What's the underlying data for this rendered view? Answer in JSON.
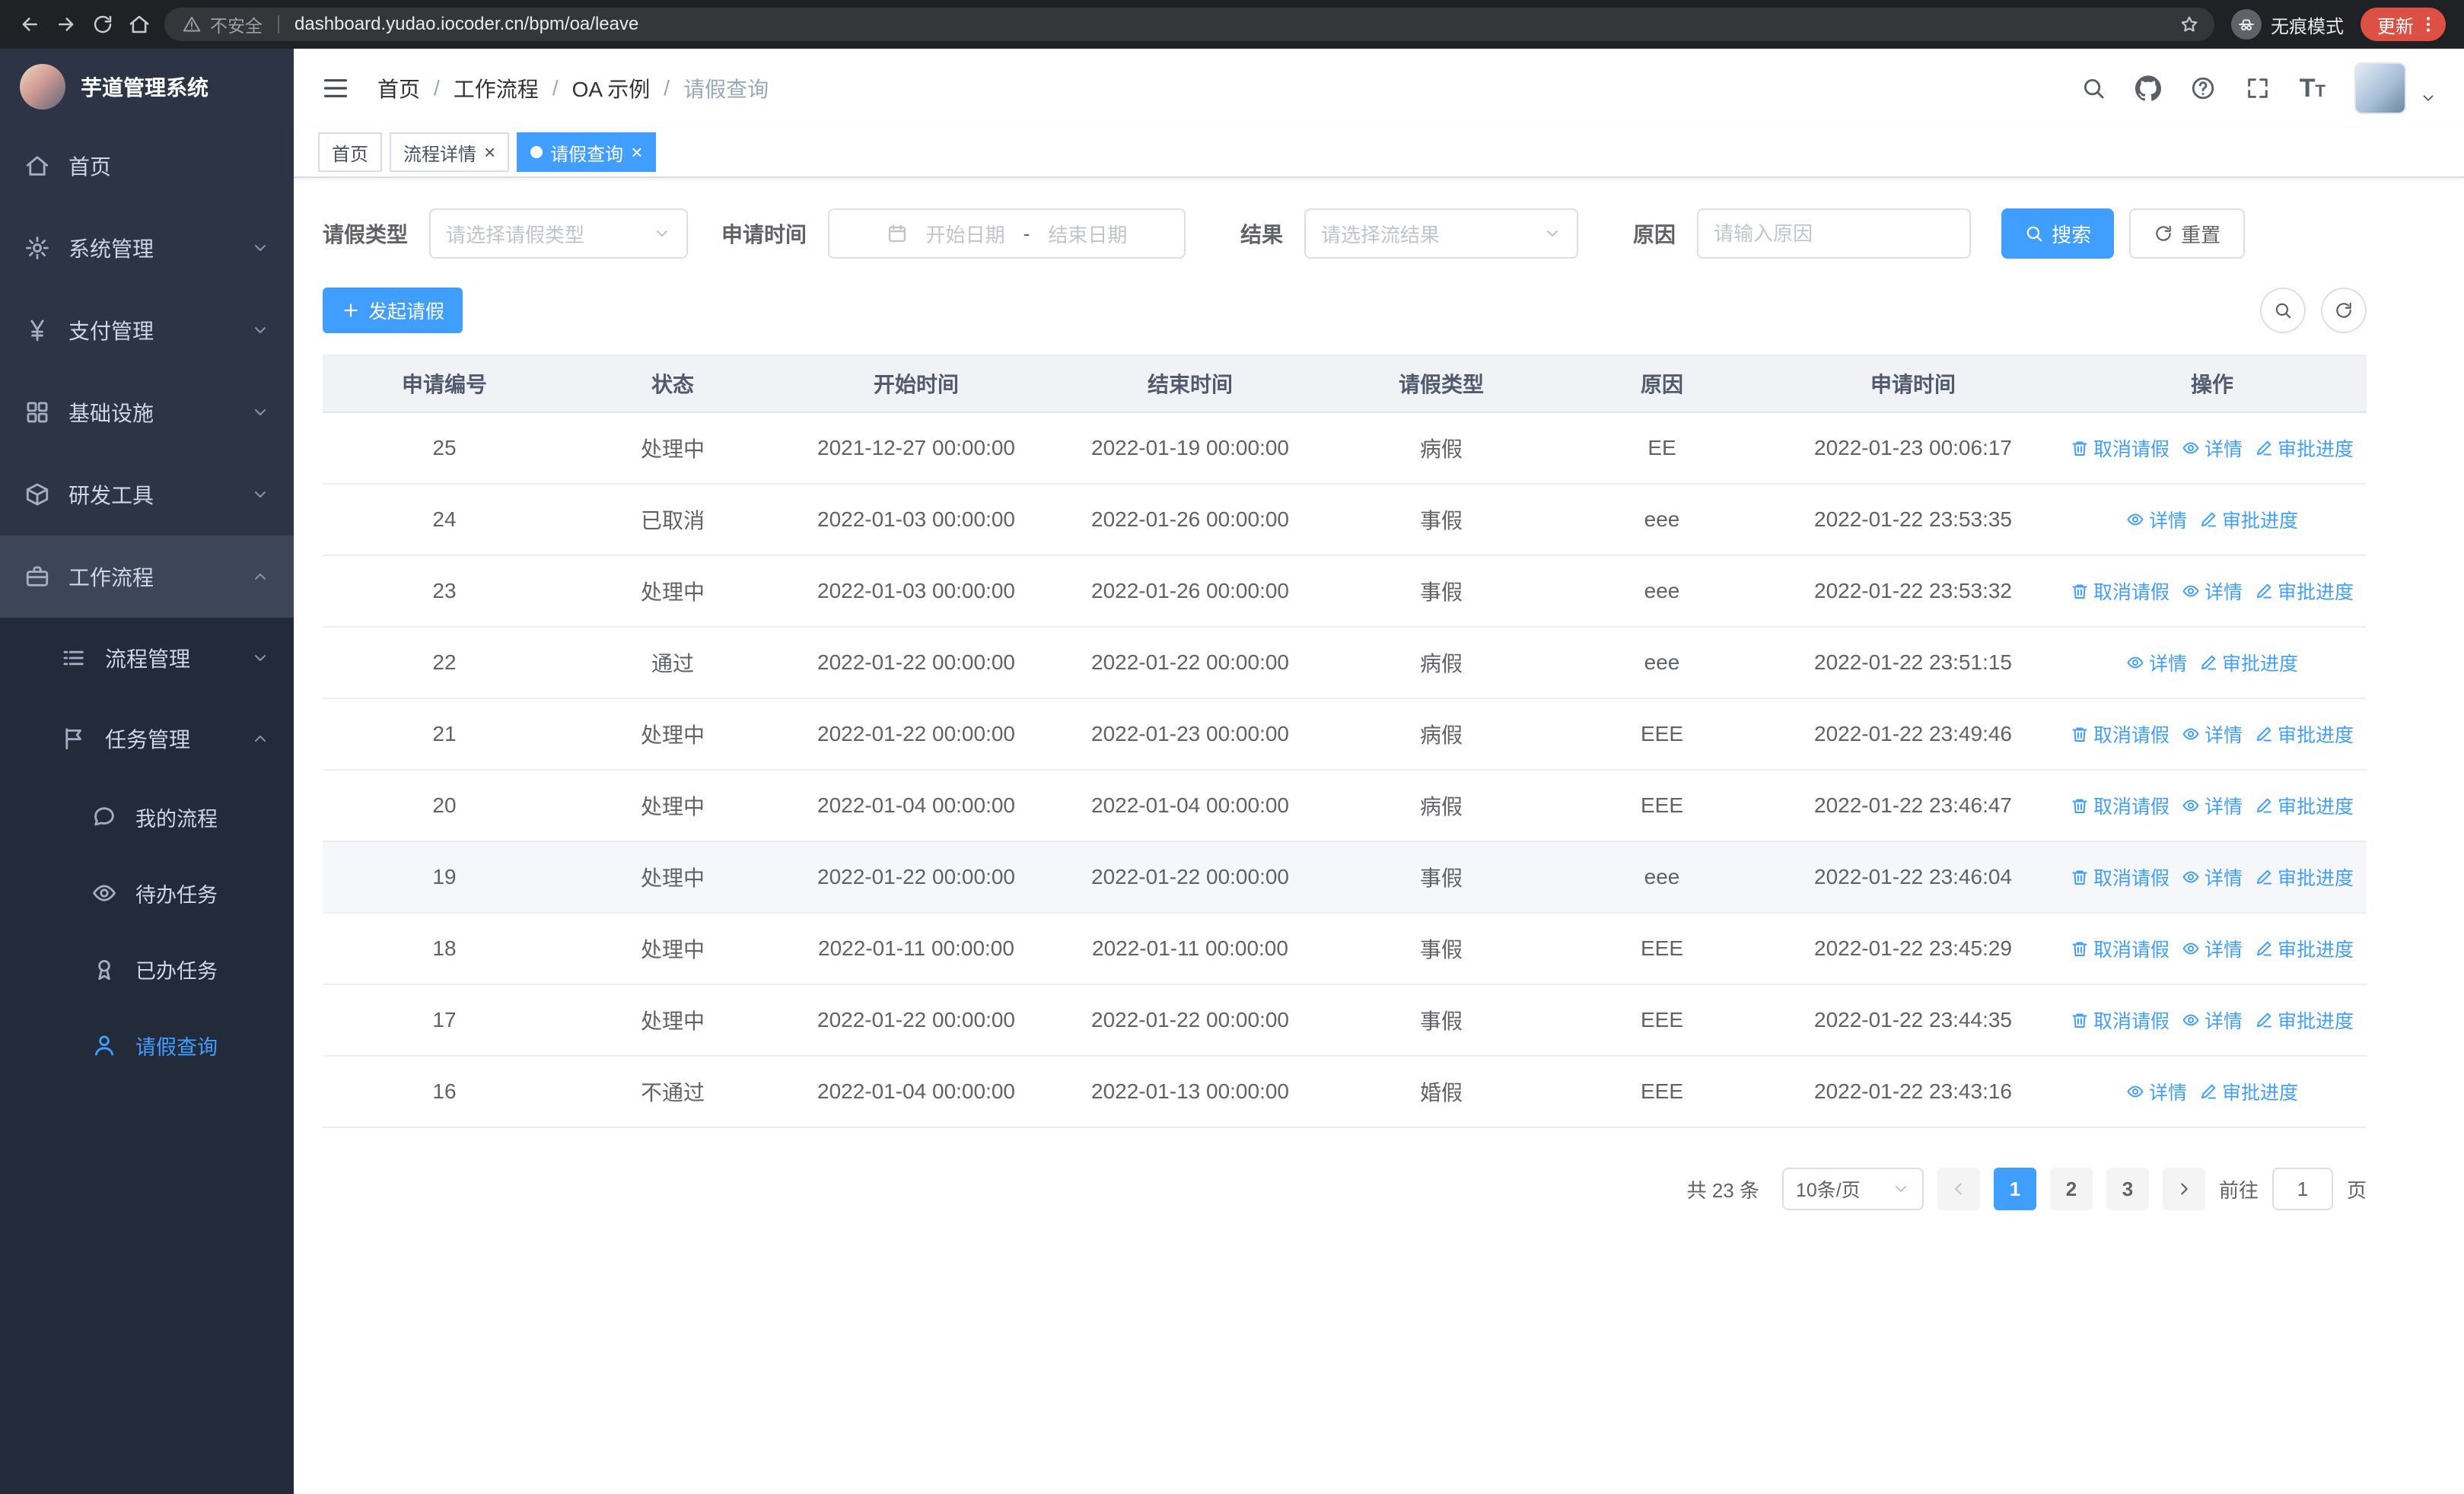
{
  "browser": {
    "security_label": "不安全",
    "url": "dashboard.yudao.iocoder.cn/bpm/oa/leave",
    "incognito_label": "无痕模式",
    "update_label": "更新"
  },
  "sidebar": {
    "title": "芋道管理系统",
    "items": [
      {
        "key": "home",
        "label": "首页",
        "icon": "home",
        "level": 1
      },
      {
        "key": "system",
        "label": "系统管理",
        "icon": "gear",
        "level": 1,
        "arrow": "down"
      },
      {
        "key": "payment",
        "label": "支付管理",
        "icon": "yen",
        "level": 1,
        "arrow": "down"
      },
      {
        "key": "infra",
        "label": "基础设施",
        "icon": "grid",
        "level": 1,
        "arrow": "down"
      },
      {
        "key": "devtools",
        "label": "研发工具",
        "icon": "box",
        "level": 1,
        "arrow": "down"
      },
      {
        "key": "workflow",
        "label": "工作流程",
        "icon": "briefcase",
        "level": 1,
        "arrow": "up",
        "highlight": true
      },
      {
        "key": "process-mgmt",
        "label": "流程管理",
        "icon": "list",
        "level": 2,
        "arrow": "down"
      },
      {
        "key": "task-mgmt",
        "label": "任务管理",
        "icon": "flag",
        "level": 2,
        "arrow": "up"
      },
      {
        "key": "my-process",
        "label": "我的流程",
        "icon": "chat",
        "level": 3
      },
      {
        "key": "todo-tasks",
        "label": "待办任务",
        "icon": "eye",
        "level": 3
      },
      {
        "key": "done-tasks",
        "label": "已办任务",
        "icon": "medal",
        "level": 3
      },
      {
        "key": "leave-query",
        "label": "请假查询",
        "icon": "user",
        "level": 3,
        "active": true
      }
    ]
  },
  "header": {
    "breadcrumb": [
      "首页",
      "工作流程",
      "OA 示例",
      "请假查询"
    ]
  },
  "tabs": [
    {
      "label": "首页",
      "closable": false,
      "active": false
    },
    {
      "label": "流程详情",
      "closable": true,
      "active": false
    },
    {
      "label": "请假查询",
      "closable": true,
      "active": true
    }
  ],
  "filters": {
    "leave_type_label": "请假类型",
    "leave_type_placeholder": "请选择请假类型",
    "apply_time_label": "申请时间",
    "start_date_placeholder": "开始日期",
    "range_separator": "-",
    "end_date_placeholder": "结束日期",
    "result_label": "结果",
    "result_placeholder": "请选择流结果",
    "reason_label": "原因",
    "reason_placeholder": "请输入原因",
    "search_label": "搜索",
    "reset_label": "重置"
  },
  "toolbar": {
    "create_label": "发起请假"
  },
  "table": {
    "columns": [
      "申请编号",
      "状态",
      "开始时间",
      "结束时间",
      "请假类型",
      "原因",
      "申请时间",
      "操作"
    ],
    "action_defs": {
      "cancel": {
        "label": "取消请假",
        "icon": "trash"
      },
      "detail": {
        "label": "详情",
        "icon": "eye"
      },
      "progress": {
        "label": "审批进度",
        "icon": "edit"
      }
    },
    "rows": [
      {
        "no": "25",
        "status": "处理中",
        "start": "2021-12-27 00:00:00",
        "end": "2022-01-19 00:00:00",
        "type": "病假",
        "reason": "EE",
        "apply_time": "2022-01-23 00:06:17",
        "actions": [
          "cancel",
          "detail",
          "progress"
        ]
      },
      {
        "no": "24",
        "status": "已取消",
        "start": "2022-01-03 00:00:00",
        "end": "2022-01-26 00:00:00",
        "type": "事假",
        "reason": "eee",
        "apply_time": "2022-01-22 23:53:35",
        "actions": [
          "detail",
          "progress"
        ]
      },
      {
        "no": "23",
        "status": "处理中",
        "start": "2022-01-03 00:00:00",
        "end": "2022-01-26 00:00:00",
        "type": "事假",
        "reason": "eee",
        "apply_time": "2022-01-22 23:53:32",
        "actions": [
          "cancel",
          "detail",
          "progress"
        ]
      },
      {
        "no": "22",
        "status": "通过",
        "start": "2022-01-22 00:00:00",
        "end": "2022-01-22 00:00:00",
        "type": "病假",
        "reason": "eee",
        "apply_time": "2022-01-22 23:51:15",
        "actions": [
          "detail",
          "progress"
        ]
      },
      {
        "no": "21",
        "status": "处理中",
        "start": "2022-01-22 00:00:00",
        "end": "2022-01-23 00:00:00",
        "type": "病假",
        "reason": "EEE",
        "apply_time": "2022-01-22 23:49:46",
        "actions": [
          "cancel",
          "detail",
          "progress"
        ]
      },
      {
        "no": "20",
        "status": "处理中",
        "start": "2022-01-04 00:00:00",
        "end": "2022-01-04 00:00:00",
        "type": "病假",
        "reason": "EEE",
        "apply_time": "2022-01-22 23:46:47",
        "actions": [
          "cancel",
          "detail",
          "progress"
        ]
      },
      {
        "no": "19",
        "status": "处理中",
        "start": "2022-01-22 00:00:00",
        "end": "2022-01-22 00:00:00",
        "type": "事假",
        "reason": "eee",
        "apply_time": "2022-01-22 23:46:04",
        "actions": [
          "cancel",
          "detail",
          "progress"
        ],
        "highlighted": true
      },
      {
        "no": "18",
        "status": "处理中",
        "start": "2022-01-11 00:00:00",
        "end": "2022-01-11 00:00:00",
        "type": "事假",
        "reason": "EEE",
        "apply_time": "2022-01-22 23:45:29",
        "actions": [
          "cancel",
          "detail",
          "progress"
        ]
      },
      {
        "no": "17",
        "status": "处理中",
        "start": "2022-01-22 00:00:00",
        "end": "2022-01-22 00:00:00",
        "type": "事假",
        "reason": "EEE",
        "apply_time": "2022-01-22 23:44:35",
        "actions": [
          "cancel",
          "detail",
          "progress"
        ]
      },
      {
        "no": "16",
        "status": "不通过",
        "start": "2022-01-04 00:00:00",
        "end": "2022-01-13 00:00:00",
        "type": "婚假",
        "reason": "EEE",
        "apply_time": "2022-01-22 23:43:16",
        "actions": [
          "detail",
          "progress"
        ]
      }
    ]
  },
  "pagination": {
    "total_label": "共 23 条",
    "page_size_label": "10条/页",
    "pages": [
      "1",
      "2",
      "3"
    ],
    "active_page": "1",
    "goto_label": "前往",
    "goto_value": "1",
    "page_unit_label": "页"
  }
}
